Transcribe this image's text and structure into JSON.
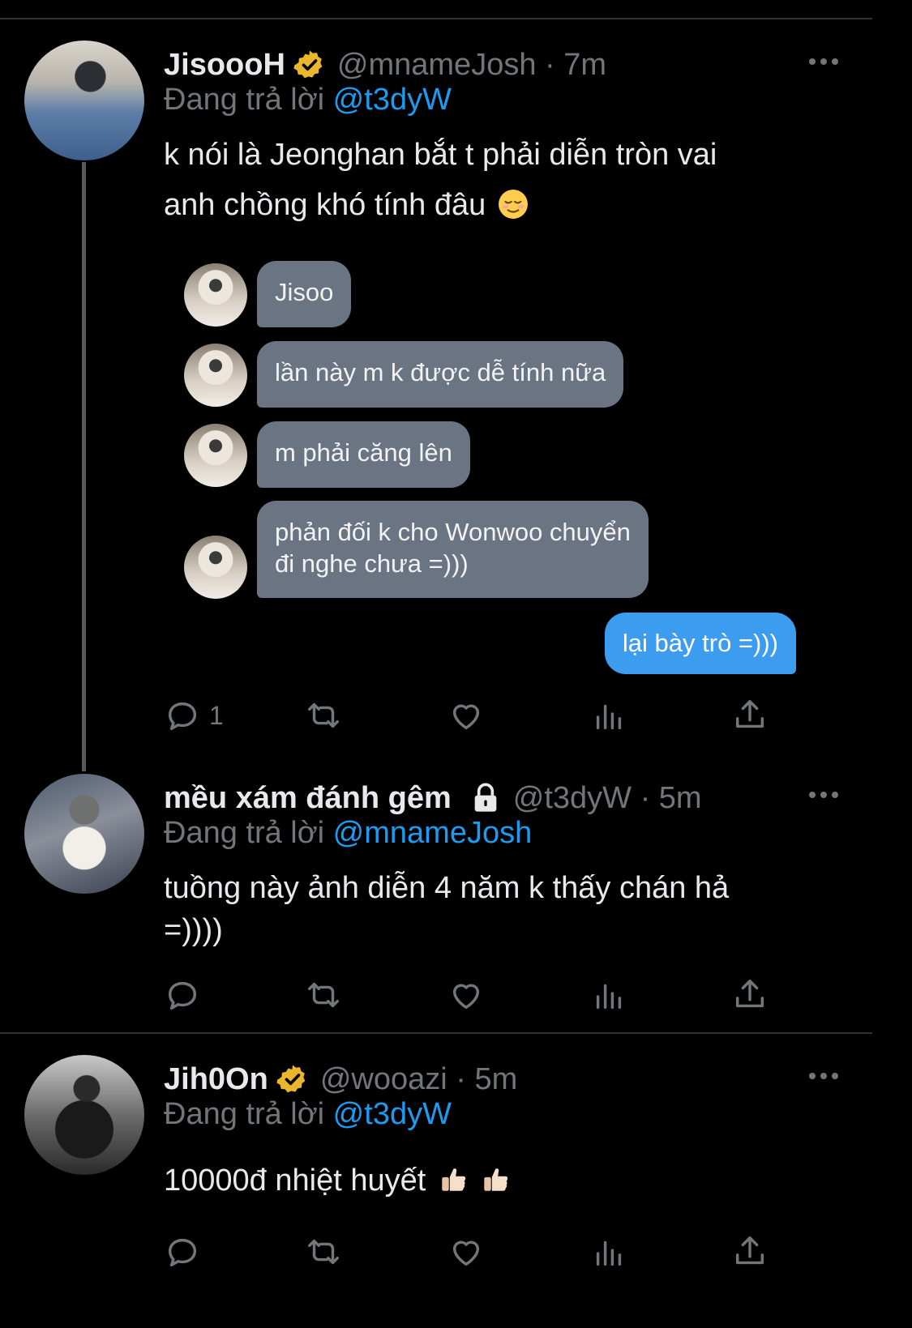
{
  "tweets": [
    {
      "name": "JisoooH",
      "handle": "@mnameJosh · 7m",
      "replying_prefix": "Đang trả lời",
      "replying_to": "@t3dyW",
      "text_line1": "k nói là Jeonghan bắt t phải diễn tròn vai",
      "text_line2": "anh chồng khó tính đâu",
      "emoji": "relieved-face",
      "reply_count": "1",
      "chat": {
        "incoming": [
          "Jisoo",
          "lần này m k được dễ tính nữa",
          "m phải căng lên"
        ],
        "incoming_multi": [
          "phản đối k cho Wonwoo chuyển",
          "đi nghe chưa =)))"
        ],
        "outgoing": "lại bày trò =)))"
      }
    },
    {
      "name": "mều xám đánh gêm",
      "handle": "@t3dyW · 5m",
      "replying_prefix": "Đang trả lời",
      "replying_to": "@mnameJosh",
      "text_line1": "tuồng này ảnh diễn 4 năm k thấy chán hả",
      "text_line2": "=))))"
    },
    {
      "name": "Jih0On",
      "handle": "@wooazi · 5m",
      "replying_prefix": "Đang trả lời",
      "replying_to": "@t3dyW",
      "text": "10000đ nhiệt huyết",
      "emoji": "thumbs-up"
    }
  ],
  "colors": {
    "background": "#000000",
    "text": "#e7e9ea",
    "secondary": "#71767b",
    "link": "#1d9bf0",
    "verified": "#e8b72c",
    "bubble_in": "#6b7482",
    "bubble_out": "#3b9cf0"
  }
}
